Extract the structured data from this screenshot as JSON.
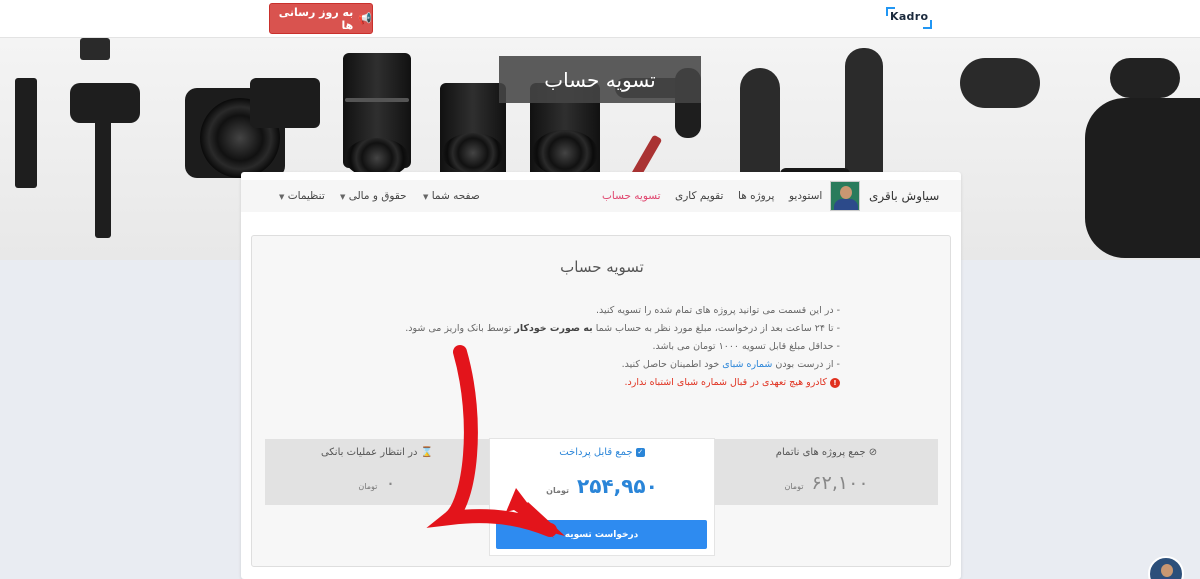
{
  "header": {
    "update_button": "به روز رسانی ها",
    "logo": "Kadro"
  },
  "hero": {
    "title": "تسویه حساب"
  },
  "nav": {
    "user_name": "سیاوش باقری",
    "items": [
      "استودیو",
      "پروژه ها",
      "تقویم کاری",
      "تسویه حساب",
      "صفحه شما",
      "حقوق و مالی",
      "تنظیمات"
    ]
  },
  "settlement": {
    "title": "تسویه حساب",
    "info": {
      "line1": "- در این قسمت می توانید پروژه های تمام شده را تسویه کنید.",
      "line2_a": "- تا ۲۴ ساعت بعد از درخواست، مبلغ مورد نظر به حساب شما ",
      "line2_b": "به صورت خودکار",
      "line2_c": " توسط بانک واریز می شود.",
      "line3": "- حداقل مبلغ قابل تسویه ۱۰۰۰ تومان می باشد.",
      "line4_a": "- از درست بودن ",
      "line4_link": "شماره شبای",
      "line4_b": " خود اطمینان حاصل کنید.",
      "warning": "کادرو هیچ تعهدی در قبال شماره شبای اشتباه ندارد."
    },
    "stats": {
      "unfinished_label": "جمع پروژه های ناتمام",
      "unfinished_value": "۶۲,۱۰۰",
      "payable_label": "جمع قابل پرداخت",
      "payable_value": "۲۵۴,۹۵۰",
      "pending_label": "در انتظار عملیات بانکی",
      "pending_value": "۰",
      "unit": "تومان"
    },
    "request_button": "درخواست تسویه"
  },
  "colors": {
    "accent": "#2e8bf0",
    "danger": "#d9534f",
    "active_nav": "#e0466f",
    "arrow": "#e3141b"
  }
}
